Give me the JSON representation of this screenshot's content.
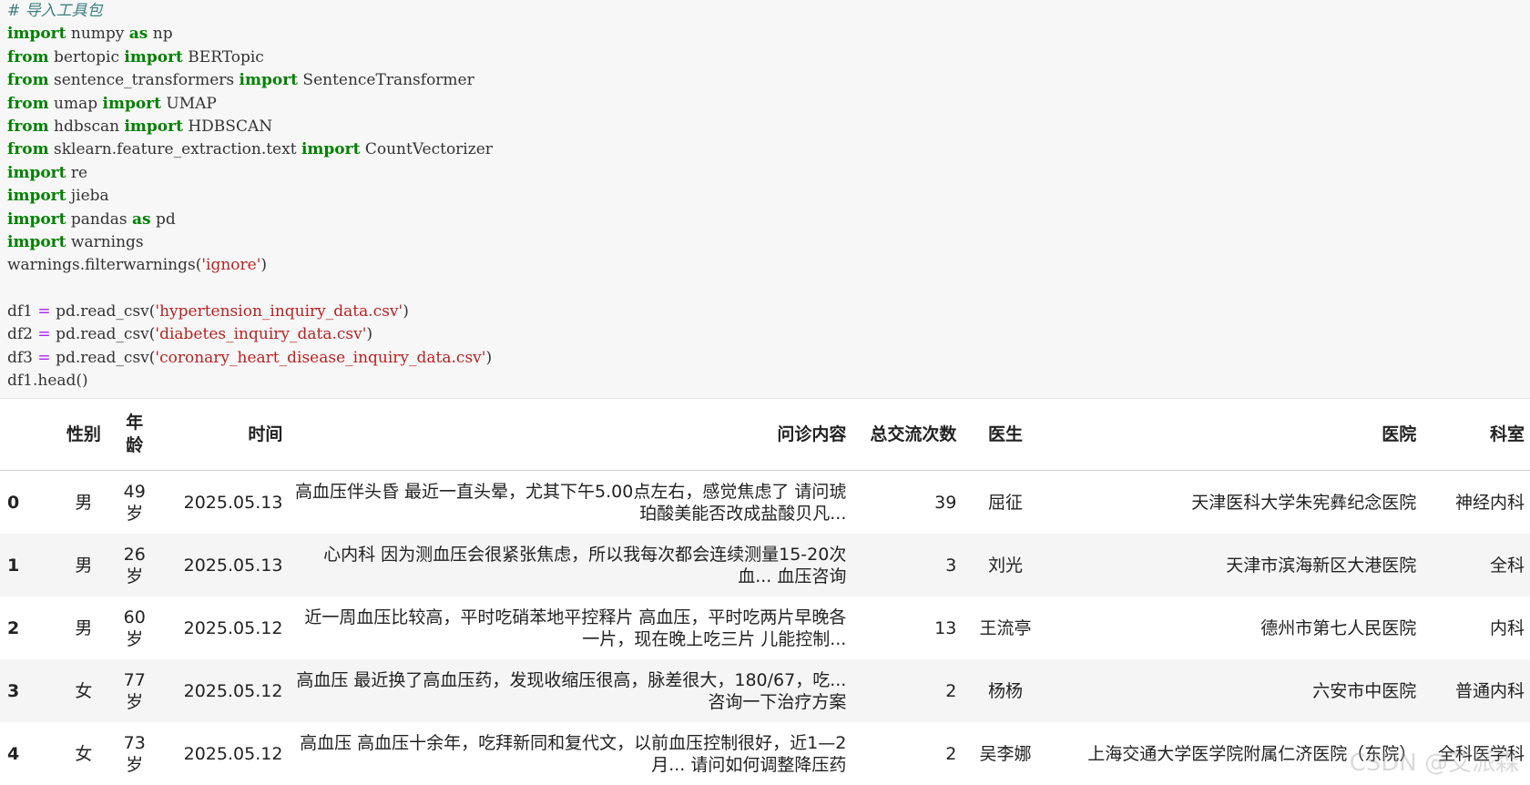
{
  "code": {
    "comment": "# 导入工具包",
    "lines": [
      {
        "kw1": "import",
        "mod": " numpy ",
        "kw2": "as",
        "rest": " np"
      },
      {
        "kw1": "from",
        "mod": " bertopic ",
        "kw2": "import",
        "rest": " BERTopic"
      },
      {
        "kw1": "from",
        "mod": " sentence_transformers ",
        "kw2": "import",
        "rest": " SentenceTransformer"
      },
      {
        "kw1": "from",
        "mod": " umap ",
        "kw2": "import",
        "rest": " UMAP"
      },
      {
        "kw1": "from",
        "mod": " hdbscan ",
        "kw2": "import",
        "rest": " HDBSCAN"
      },
      {
        "kw1": "from",
        "mod": " sklearn.feature_extraction.text ",
        "kw2": "import",
        "rest": " CountVectorizer"
      },
      {
        "kw1": "import",
        "mod": " re",
        "kw2": "",
        "rest": ""
      },
      {
        "kw1": "import",
        "mod": " jieba",
        "kw2": "",
        "rest": ""
      },
      {
        "kw1": "import",
        "mod": " pandas ",
        "kw2": "as",
        "rest": " pd"
      },
      {
        "kw1": "import",
        "mod": " warnings",
        "kw2": "",
        "rest": ""
      }
    ],
    "filter_call": "warnings.filterwarnings(",
    "filter_arg": "'ignore'",
    "filter_close": ")",
    "reads": [
      {
        "var": "df1",
        "eq": " = ",
        "call": "pd.read_csv(",
        "arg": "'hypertension_inquiry_data.csv'",
        "close": ")"
      },
      {
        "var": "df2",
        "eq": " = ",
        "call": "pd.read_csv(",
        "arg": "'diabetes_inquiry_data.csv'",
        "close": ")"
      },
      {
        "var": "df3",
        "eq": " = ",
        "call": "pd.read_csv(",
        "arg": "'coronary_heart_disease_inquiry_data.csv'",
        "close": ")"
      }
    ],
    "head_call": "df1.head()"
  },
  "table": {
    "headers": {
      "gender": "性别",
      "age": "年龄",
      "time": "时间",
      "content": "问诊内容",
      "count": "总交流次数",
      "doctor": "医生",
      "hospital": "医院",
      "dept": "科室"
    },
    "rows": [
      {
        "idx": "0",
        "gender": "男",
        "age": "49岁",
        "time": "2025.05.13",
        "content": "高血压伴头昏 最近一直头晕，尤其下午5.00点左右，感觉焦虑了 请问琥珀酸美能否改成盐酸贝凡...",
        "count": "39",
        "doctor": "屈征",
        "hospital": "天津医科大学朱宪彝纪念医院",
        "dept": "神经内科"
      },
      {
        "idx": "1",
        "gender": "男",
        "age": "26岁",
        "time": "2025.05.13",
        "content": "心内科 因为测血压会很紧张焦虑，所以我每次都会连续测量15-20次血... 血压咨询",
        "count": "3",
        "doctor": "刘光",
        "hospital": "天津市滨海新区大港医院",
        "dept": "全科"
      },
      {
        "idx": "2",
        "gender": "男",
        "age": "60岁",
        "time": "2025.05.12",
        "content": "近一周血压比较高，平时吃硝苯地平控释片 高血压，平时吃两片早晚各一片，现在晚上吃三片 儿能控制...",
        "count": "13",
        "doctor": "王流亭",
        "hospital": "德州市第七人民医院",
        "dept": "内科"
      },
      {
        "idx": "3",
        "gender": "女",
        "age": "77岁",
        "time": "2025.05.12",
        "content": "高血压 最近换了高血压药，发现收缩压很高，脉差很大，180/67，吃... 咨询一下治疗方案",
        "count": "2",
        "doctor": "杨杨",
        "hospital": "六安市中医院",
        "dept": "普通内科"
      },
      {
        "idx": "4",
        "gender": "女",
        "age": "73岁",
        "time": "2025.05.12",
        "content": "高血压 高血压十余年，吃拜新同和复代文，以前血压控制很好，近1—2月... 请问如何调整降压药",
        "count": "2",
        "doctor": "吴李娜",
        "hospital": "上海交通大学医学院附属仁济医院（东院）",
        "dept": "全科医学科"
      }
    ]
  },
  "watermark": "CSDN @艾派森"
}
